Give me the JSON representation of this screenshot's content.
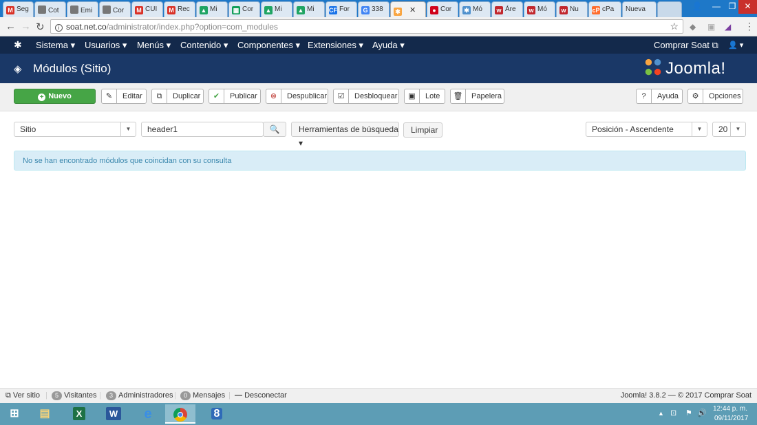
{
  "tabs": [
    {
      "label": "Seg",
      "icon": "gmail-icon",
      "color": "#d93025",
      "glyph": "M"
    },
    {
      "label": "Cot",
      "icon": "document-icon",
      "color": "#777",
      "glyph": ""
    },
    {
      "label": "Emi",
      "icon": "document-icon",
      "color": "#777",
      "glyph": ""
    },
    {
      "label": "Cor",
      "icon": "document-icon",
      "color": "#777",
      "glyph": ""
    },
    {
      "label": "CUI",
      "icon": "gmail-icon",
      "color": "#d93025",
      "glyph": "M"
    },
    {
      "label": "Rec",
      "icon": "gmail-icon",
      "color": "#d93025",
      "glyph": "M"
    },
    {
      "label": "Mi",
      "icon": "drive-icon",
      "color": "#1fa463",
      "glyph": "▲"
    },
    {
      "label": "Cor",
      "icon": "sheets-icon",
      "color": "#0f9d58",
      "glyph": "▦"
    },
    {
      "label": "Mi",
      "icon": "drive-icon",
      "color": "#1fa463",
      "glyph": "▲"
    },
    {
      "label": "Mi",
      "icon": "drive-icon",
      "color": "#1fa463",
      "glyph": "▲"
    },
    {
      "label": "For",
      "icon": "forms-icon",
      "color": "#1a73e8",
      "glyph": "CF"
    },
    {
      "label": "338",
      "icon": "google-icon",
      "color": "#4285f4",
      "glyph": "G"
    },
    {
      "label": "",
      "icon": "joomla-icon",
      "color": "#f9a541",
      "glyph": "✱",
      "active": true
    },
    {
      "label": "Cor",
      "icon": "drop-icon",
      "color": "#d0021b",
      "glyph": "●"
    },
    {
      "label": "Mó",
      "icon": "joomla-icon",
      "color": "#5091cd",
      "glyph": "✱"
    },
    {
      "label": "Áre",
      "icon": "w-icon",
      "color": "#c1272d",
      "glyph": "w"
    },
    {
      "label": "Mó",
      "icon": "w-icon",
      "color": "#c1272d",
      "glyph": "w"
    },
    {
      "label": "Nu",
      "icon": "w-icon",
      "color": "#c1272d",
      "glyph": "w"
    },
    {
      "label": "cPa",
      "icon": "cpanel-icon",
      "color": "#ff6c2c",
      "glyph": "cP"
    },
    {
      "label": "Nueva",
      "icon": "",
      "color": "",
      "glyph": ""
    }
  ],
  "address": {
    "host": "soat.net.co",
    "path": "/administrator/index.php?option=com_modules"
  },
  "topnav": {
    "menu": [
      "Sistema ▾",
      "Usuarios ▾",
      "Menús ▾",
      "Contenido ▾",
      "Componentes ▾",
      "Extensiones ▾",
      "Ayuda ▾"
    ],
    "right_link": "Comprar Soat ⧉",
    "user": "👤 ▾"
  },
  "header": {
    "title": "Módulos (Sitio)",
    "logo_text": "Joomla!"
  },
  "toolbar": {
    "new": "Nuevo",
    "edit": "Editar",
    "duplicate": "Duplicar",
    "publish": "Publicar",
    "unpublish": "Despublicar",
    "unlock": "Desbloquear",
    "batch": "Lote",
    "trash": "Papelera",
    "help": "Ayuda",
    "options": "Opciones"
  },
  "filters": {
    "client": "Sitio",
    "search_value": "header1",
    "search_tools": "Herramientas de búsqueda ▾",
    "clear": "Limpiar",
    "ordering": "Posición - Ascendente",
    "limit": "20"
  },
  "message": "No se han encontrado módulos que coincidan con su consulta",
  "footer": {
    "view_site": "Ver sitio",
    "visitors_count": "5",
    "visitors": "Visitantes",
    "admins_count": "3",
    "admins": "Administradores",
    "messages_count": "0",
    "messages": "Mensajes",
    "logout": "Desconectar",
    "copyright": "Joomla! 3.8.2 — © 2017 Comprar Soat"
  },
  "clock": {
    "time": "12:44 p. m.",
    "date": "09/11/2017"
  }
}
